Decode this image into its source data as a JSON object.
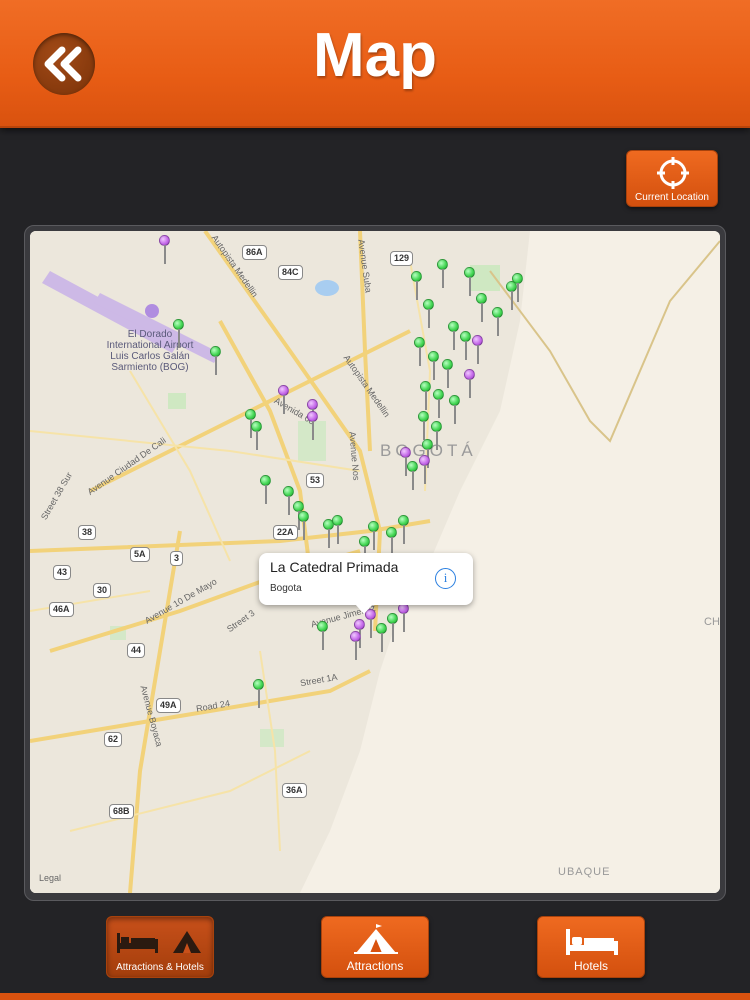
{
  "header": {
    "title": "Map"
  },
  "current_location": {
    "label": "Current Location"
  },
  "map": {
    "airport_label": "El Dorado International Airport Luis Carlos Galán Sarmiento (BOG)",
    "city_label": "BOGOTÁ",
    "ubaque_label": "UBAQUE",
    "edge_label": "CH",
    "legal": "Legal",
    "shields": [
      "86A",
      "84C",
      "129",
      "53",
      "22A",
      "38",
      "5A",
      "3",
      "43",
      "30",
      "46A",
      "44",
      "49A",
      "62",
      "68B",
      "36A"
    ],
    "roads": [
      "Autopista Medellin",
      "Autopista Medellin",
      "Avenue Suba",
      "Avenue Nos",
      "Avenida 68",
      "Avenue Ciudad De Cali",
      "Street 38 Sur",
      "Avenue 10 De Mayo",
      "Avenue Boyaca",
      "Road 24",
      "Street 1A",
      "Avenue Jimenez",
      "Street 3"
    ],
    "callout": {
      "title": "La Catedral Primada",
      "subtitle": "Bogota",
      "info": "i"
    }
  },
  "tabs": [
    {
      "label": "Attractions & Hotels",
      "icon": "bed-and-tent-icon",
      "active": true
    },
    {
      "label": "Attractions",
      "icon": "tent-icon",
      "active": false
    },
    {
      "label": "Hotels",
      "icon": "bed-icon",
      "active": false
    }
  ],
  "colors": {
    "accent": "#e85d15",
    "background": "#232326",
    "pin_green": "#3fd44f",
    "pin_purple": "#c264e8"
  }
}
